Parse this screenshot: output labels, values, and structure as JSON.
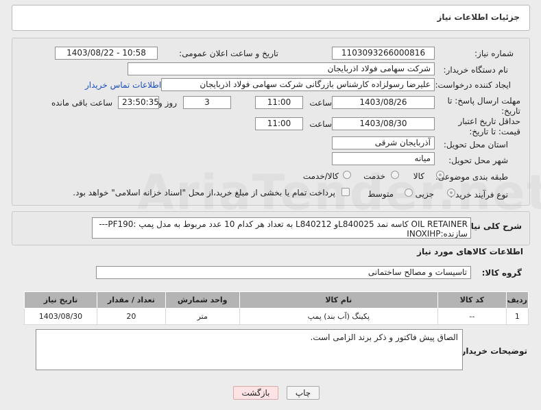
{
  "header": {
    "title": "جزئیات اطلاعات نیاز"
  },
  "form": {
    "need_number_label": "شماره نیاز:",
    "need_number": "1103093266000816",
    "announce_label": "تاریخ و ساعت اعلان عمومی:",
    "announce_value": "1403/08/22 - 10:58",
    "buyer_label": "نام دستگاه خریدار:",
    "buyer_value": "شرکت سهامی فولاد اذربایجان",
    "creator_label": "ایجاد کننده درخواست:",
    "creator_value": "علیرضا رسولزاده کارشناس بازرگانی شرکت سهامی فولاد اذربایجان",
    "contact_link": "اطلاعات تماس خریدار",
    "deadline_label": "مهلت ارسال پاسخ: تا تاریخ:",
    "deadline_date": "1403/08/26",
    "time_label": "ساعت",
    "deadline_time": "11:00",
    "days_value": "3",
    "days_label": "روز و",
    "remaining_time": "23:50:35",
    "remaining_label": "ساعت باقی مانده",
    "validity_label": "حداقل تاریخ اعتبار قیمت: تا تاریخ:",
    "validity_date": "1403/08/30",
    "validity_time_label": "ساعت",
    "validity_time": "11:00",
    "province_label": "استان محل تحویل:",
    "province_value": "آذربایجان شرقی",
    "city_label": "شهر محل تحویل:",
    "city_value": "میانه",
    "category_label": "طبقه بندی موضوعی:",
    "category_options": [
      "کالا",
      "خدمت",
      "کالا/خدمت"
    ],
    "process_label": "نوع فرآیند خرید :",
    "process_options": [
      "جزیی",
      "متوسط"
    ],
    "payment_note": "پرداخت تمام یا بخشی از مبلغ خرید،از محل \"اسناد خزانه اسلامی\" خواهد بود."
  },
  "need_desc": {
    "label": "شرح کلی نیاز:",
    "text": "OIL RETAINER کاسه نمد L840025و L840212 به تعداد هر کدام 10 عدد  مربوط به مدل پمپ :PF190---سازنده:INOXIHP"
  },
  "goods_info": {
    "title": "اطلاعات کالاهای مورد نیاز",
    "group_label": "گروه کالا:",
    "group_value": "تاسیسات و مصالح ساختمانی"
  },
  "table": {
    "headers": [
      "ردیف",
      "کد کالا",
      "نام کالا",
      "واحد شمارش",
      "تعداد / مقدار",
      "تاریخ نیاز"
    ],
    "rows": [
      [
        "1",
        "--",
        "پکینگ (آب بند) پمپ",
        "متر",
        "20",
        "1403/08/30"
      ]
    ]
  },
  "notes": {
    "label": "توضیحات خریدار:",
    "text": "الصاق پیش فاکتور و ذکر برند الزامی است."
  },
  "buttons": {
    "print": "چاپ",
    "back": "بازگشت"
  },
  "watermark": "AriaTender.net"
}
